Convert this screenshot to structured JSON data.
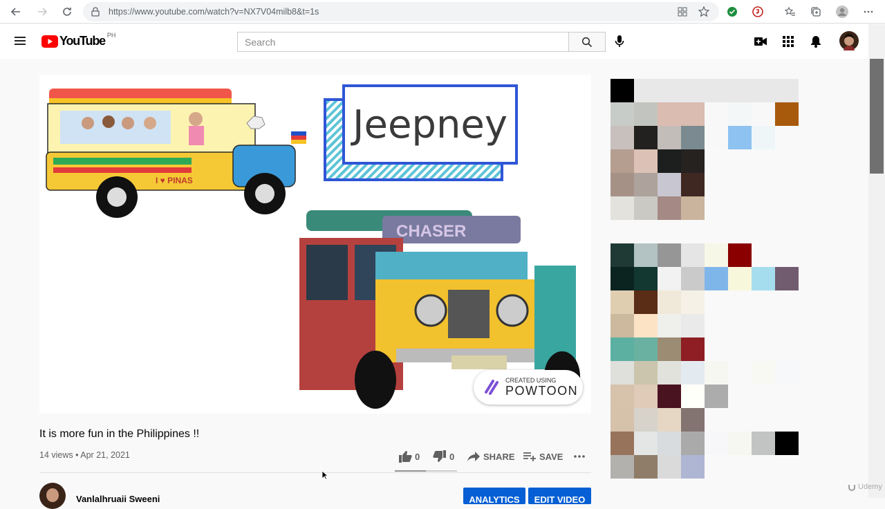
{
  "browser": {
    "url": "https://www.youtube.com/watch?v=NX7V04milb8&t=1s"
  },
  "header": {
    "logo_text": "YouTube",
    "country": "PH",
    "search_placeholder": "Search"
  },
  "video": {
    "title_card": "Jeepney",
    "watermark_line1": "CREATED USING",
    "watermark_line2": "POWTOON",
    "banner_text": "I ♥ PINAS",
    "plate_text": "CHASER"
  },
  "info": {
    "title": "It is more fun in the Philippines !!",
    "meta": "14 views • Apr 21, 2021",
    "likes": "0",
    "dislikes": "0",
    "share_label": "SHARE",
    "save_label": "SAVE",
    "like_ratio": 0.5,
    "channel_name": "Vanlalhruaii Sweeni",
    "analytics_label": "ANALYTICS",
    "edit_label": "EDIT VIDEO"
  },
  "udemy_watermark": "Udemy",
  "swatches_top": [
    [
      "#000000",
      "#e8e8e8",
      "#e8e8e8",
      "#e8e8e8",
      "#e8e8e8",
      "#e8e8e8",
      "#e8e8e8",
      "#e8e8e8"
    ],
    [
      "#c8ccc9",
      "#c2c5bf",
      "#dbbcb1",
      "#dbbcb1",
      "#f8f8f8",
      "#f4f7f8",
      "#f8f8f8",
      "#a85a0c"
    ],
    [
      "#c8c0bd",
      "#232120",
      "#c2bdb9",
      "#7a8a90",
      "#f8f8f8",
      "#8ec2f1",
      "#eef6f8",
      "#f9f9f9"
    ],
    [
      "#b59e90",
      "#dcc2b6",
      "#1d1f1e",
      "#252220",
      "#f9f9f9",
      "#f9f9f9",
      "#f9f9f9",
      "#f9f9f9"
    ],
    [
      "#a69187",
      "#aea29c",
      "#c8c6d0",
      "#3f2722",
      "#f9f9f9",
      "#f9f9f9",
      "#f9f9f9",
      "#f9f9f9"
    ],
    [
      "#e3e2dc",
      "#cbc9c4",
      "#a48984",
      "#cab49d",
      "#f9f9f9",
      "#f9f9f9",
      "#f9f9f9",
      "#f9f9f9"
    ]
  ],
  "swatches_bottom": [
    [
      "#1f3a35",
      "#b3c2c2",
      "#969696",
      "#e5e5e5",
      "#f7f7e7",
      "#8a0000",
      "#f9f9f9",
      "#f9f9f9"
    ],
    [
      "#0b2420",
      "#133731",
      "#f2f2f2",
      "#cacaca",
      "#7fb6ea",
      "#f7f7dc",
      "#a6ddee",
      "#715b6f"
    ],
    [
      "#e0ceb1",
      "#5a2d17",
      "#f0e9d9",
      "#f5f1e7",
      "#f9f9f9",
      "#f9f9f9",
      "#f9f9f9",
      "#f9f9f9"
    ],
    [
      "#ccb99e",
      "#fde3c6",
      "#efefec",
      "#eaeaea",
      "#f9f9f9",
      "#f9f9f9",
      "#f9f9f9",
      "#f9f9f9"
    ],
    [
      "#5bb0a1",
      "#6bb1a2",
      "#9b8c73",
      "#8e1e24",
      "#f9f9f9",
      "#f9f9f9",
      "#f9f9f9",
      "#f9f9f9"
    ],
    [
      "#dfdfdc",
      "#cbc5ad",
      "#e1e2dc",
      "#e3ebf1",
      "#f7f7f2",
      "#f9f9f9",
      "#f7f9f2",
      "#f6f8f9"
    ],
    [
      "#d7c2ac",
      "#e0cab8",
      "#4a1320",
      "#fffff9",
      "#acacac",
      "#f9f9f9",
      "#f9f9f9",
      "#f9f9f9"
    ],
    [
      "#d6c1ab",
      "#d7d3cb",
      "#e6d6c4",
      "#847471",
      "#f9f9f9",
      "#f9f9f9",
      "#f9f9f9",
      "#f9f9f9"
    ],
    [
      "#98735b",
      "#e3e6e5",
      "#d8dcdf",
      "#aaaaaa",
      "#f7f7f9",
      "#f6f7f1",
      "#c2c4c4",
      "#000000"
    ],
    [
      "#b3b1ae",
      "#8f7d6a",
      "#dadada",
      "#afb6d4",
      "#f9f9f9",
      "#f9f9f9",
      "#f9f9f9",
      "#f9f9f9"
    ]
  ]
}
